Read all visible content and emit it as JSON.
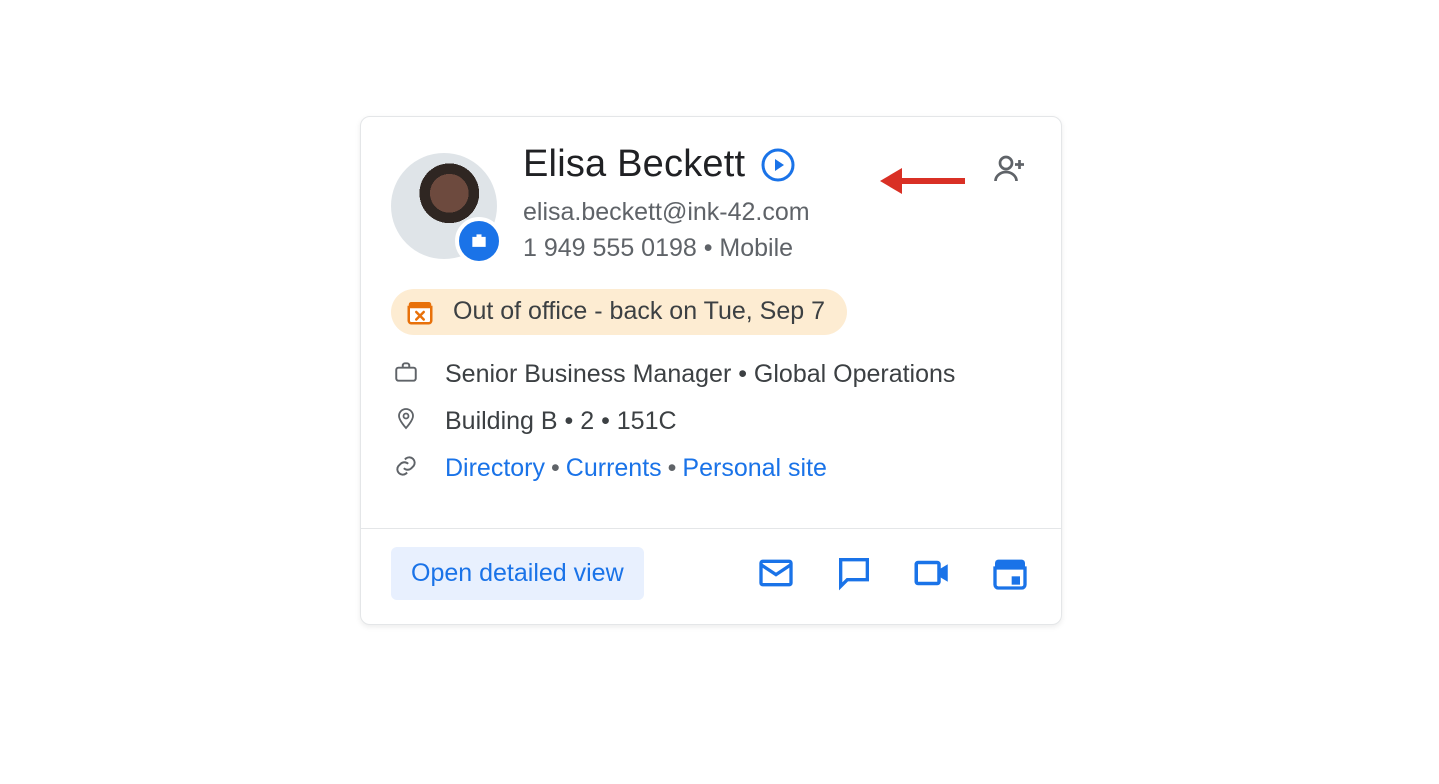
{
  "person": {
    "name": "Elisa Beckett",
    "email": "elisa.beckett@ink-42.com",
    "phone": "1 949 555 0198 • Mobile"
  },
  "status": {
    "text": "Out of office - back on Tue, Sep 7"
  },
  "details": {
    "job": "Senior Business Manager • Global Operations",
    "location": "Building B • 2 • 151C",
    "links": {
      "directory": "Directory",
      "currents": "Currents",
      "personal": "Personal site"
    }
  },
  "footer": {
    "open_label": "Open detailed view"
  },
  "icons": {
    "avatar_badge": "briefcase-icon",
    "play": "play-circle-icon",
    "add_person": "add-person-icon",
    "status": "calendar-x-icon",
    "job": "briefcase-outline-icon",
    "location": "location-pin-icon",
    "link": "link-icon",
    "mail": "mail-icon",
    "chat": "chat-icon",
    "video": "video-icon",
    "calendar": "calendar-icon",
    "annotation": "arrow-left-icon"
  },
  "colors": {
    "accent": "#1a73e8",
    "status_bg": "#fdecd2",
    "status_icon": "#e8710a",
    "annotation": "#d93025"
  }
}
